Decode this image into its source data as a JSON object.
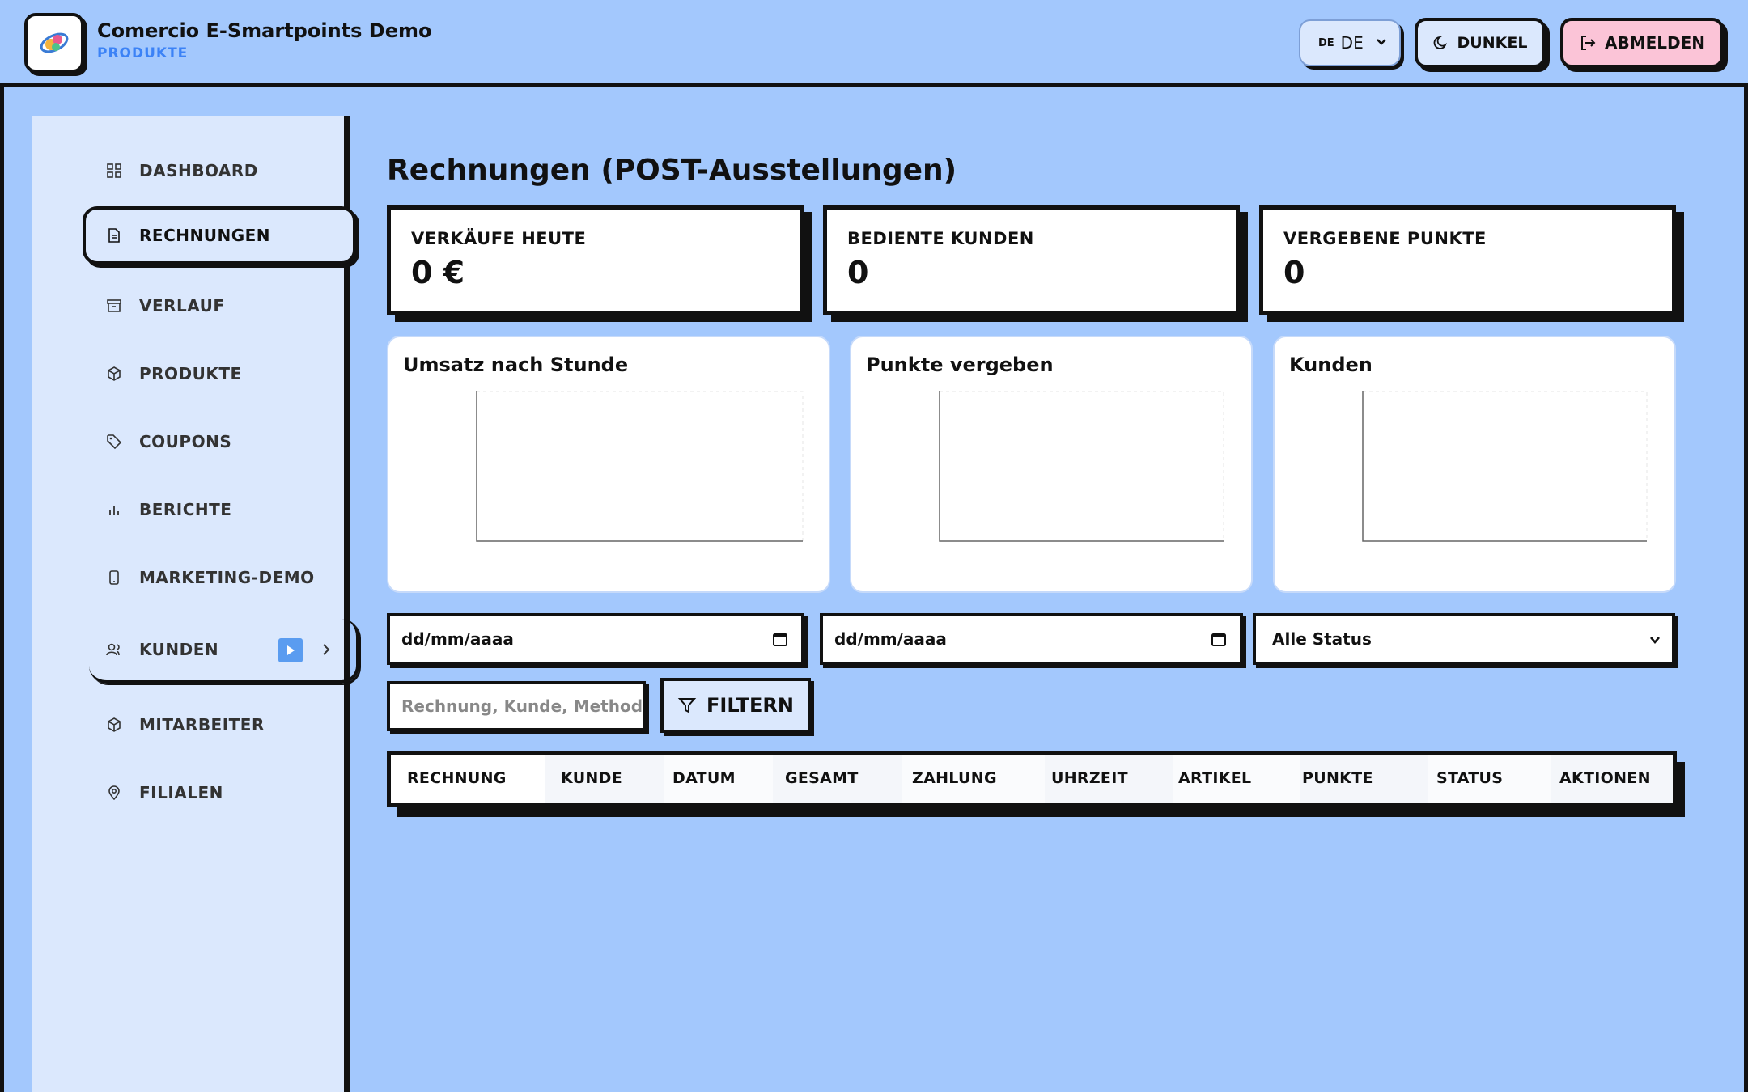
{
  "header": {
    "app_title": "Comercio E-Smartpoints Demo",
    "app_subtitle": "PRODUKTE",
    "language_flag": "DE",
    "language_value": "DE",
    "dark_label": "DUNKEL",
    "logout_label": "ABMELDEN"
  },
  "sidebar": {
    "items": [
      {
        "label": "DASHBOARD",
        "icon": "grid-icon"
      },
      {
        "label": "RECHNUNGEN",
        "icon": "document-icon",
        "active": true
      },
      {
        "label": "VERLAUF",
        "icon": "archive-icon"
      },
      {
        "label": "PRODUKTE",
        "icon": "box-icon"
      },
      {
        "label": "COUPONS",
        "icon": "tag-icon"
      },
      {
        "label": "BERICHTE",
        "icon": "bar-chart-icon"
      },
      {
        "label": "MARKETING-DEMO",
        "icon": "smartphone-icon"
      },
      {
        "label": "KUNDEN",
        "icon": "users-icon",
        "expandable": true
      },
      {
        "label": "MITARBEITER",
        "icon": "box-icon"
      },
      {
        "label": "FILIALEN",
        "icon": "map-pin-icon"
      }
    ]
  },
  "main": {
    "page_title": "Rechnungen (POST-Ausstellungen)",
    "stats": [
      {
        "label": "VERKÄUFE HEUTE",
        "value": "0 €"
      },
      {
        "label": "BEDIENTE KUNDEN",
        "value": "0"
      },
      {
        "label": "VERGEBENE PUNKTE",
        "value": "0"
      }
    ],
    "charts": [
      {
        "title": "Umsatz nach Stunde"
      },
      {
        "title": "Punkte vergeben"
      },
      {
        "title": "Kunden"
      }
    ],
    "filters": {
      "date_from_placeholder": "dd/mm/aaaa",
      "date_to_placeholder": "dd/mm/aaaa",
      "status_value": "Alle Status",
      "search_placeholder": "Rechnung, Kunde, Methode s",
      "filter_label": "FILTERN"
    },
    "table": {
      "columns": [
        "RECHNUNG",
        "KUNDE",
        "DATUM",
        "GESAMT",
        "ZAHLUNG",
        "UHRZEIT",
        "ARTIKEL",
        "PUNKTE",
        "STATUS",
        "AKTIONEN"
      ],
      "rows": []
    }
  },
  "colors": {
    "background": "#a3c8fd",
    "sidebar": "#dbe8fd",
    "accent": "#3b82f6",
    "logout": "#fbc4d7",
    "border": "#111111"
  }
}
